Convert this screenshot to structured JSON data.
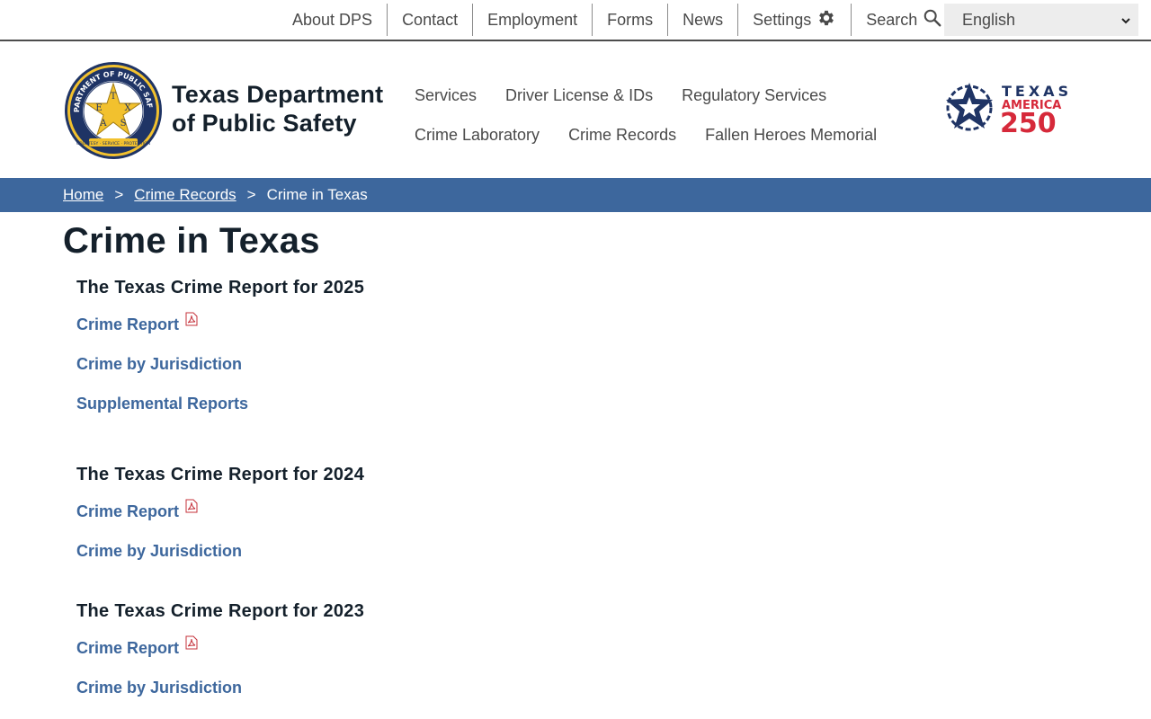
{
  "utility_nav": {
    "items": [
      "About DPS",
      "Contact",
      "Employment",
      "Forms",
      "News",
      "Settings",
      "Search"
    ],
    "language": "English"
  },
  "header": {
    "agency_line1": "Texas Department",
    "agency_line2": "of Public Safety",
    "seal": {
      "top_text": "DEPARTMENT OF PUBLIC SAFETY",
      "letters": [
        "T",
        "E",
        "X",
        "A",
        "S"
      ],
      "motto": "COURTESY · SERVICE · PROTECTION"
    },
    "america250": {
      "line1": "TEXAS",
      "line2": "AMERICA",
      "line3": "250"
    }
  },
  "main_nav": {
    "row1": [
      "Services",
      "Driver License & IDs",
      "Regulatory Services"
    ],
    "row2": [
      "Crime Laboratory",
      "Crime Records",
      "Fallen Heroes Memorial"
    ]
  },
  "breadcrumb": {
    "home": "Home",
    "sep": ">",
    "parent": "Crime Records",
    "current": "Crime in Texas"
  },
  "page": {
    "title": "Crime in Texas",
    "sections": [
      {
        "heading": "The Texas Crime Report for 2025",
        "links": [
          "Crime Report",
          "Crime by Jurisdiction",
          "Supplemental Reports"
        ]
      },
      {
        "heading": "The Texas Crime Report for 2024",
        "links": [
          "Crime Report",
          "Crime by Jurisdiction"
        ]
      },
      {
        "heading": "The Texas Crime Report for 2023",
        "links": [
          "Crime Report",
          "Crime by Jurisdiction"
        ]
      }
    ]
  },
  "colors": {
    "brand_blue": "#3d679d",
    "navy": "#1f3465",
    "red": "#d6293a",
    "gold": "#f2c12e"
  },
  "icons": [
    "gear-icon",
    "search-icon",
    "chevron-down-icon",
    "pdf-icon"
  ]
}
